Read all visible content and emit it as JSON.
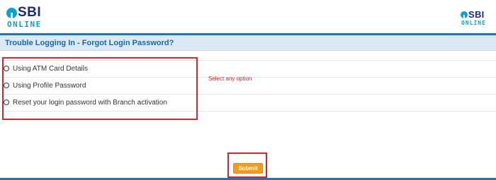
{
  "header": {
    "logo_left": {
      "brand": "SBI",
      "sub": "ONLINE"
    },
    "logo_right": {
      "brand": "SBI",
      "sub": "ONLINE"
    }
  },
  "page": {
    "title": "Trouble Logging In - Forgot Login Password?"
  },
  "options": [
    {
      "label": "Using ATM Card Details",
      "selected": false
    },
    {
      "label": "Using Profile Password",
      "selected": false
    },
    {
      "label": "Reset your login password with Branch activation",
      "selected": false
    }
  ],
  "hint": "Select any option",
  "submit_label": "Submit",
  "colors": {
    "brand_blue": "#1f73b7",
    "logo_cyan": "#0b9fd8",
    "logo_navy": "#1b2a7b",
    "title_bar_bg": "#dbe9f4",
    "title_text": "#1b67a8",
    "highlight_red": "#d8232a",
    "submit_orange": "#f39c1e"
  }
}
